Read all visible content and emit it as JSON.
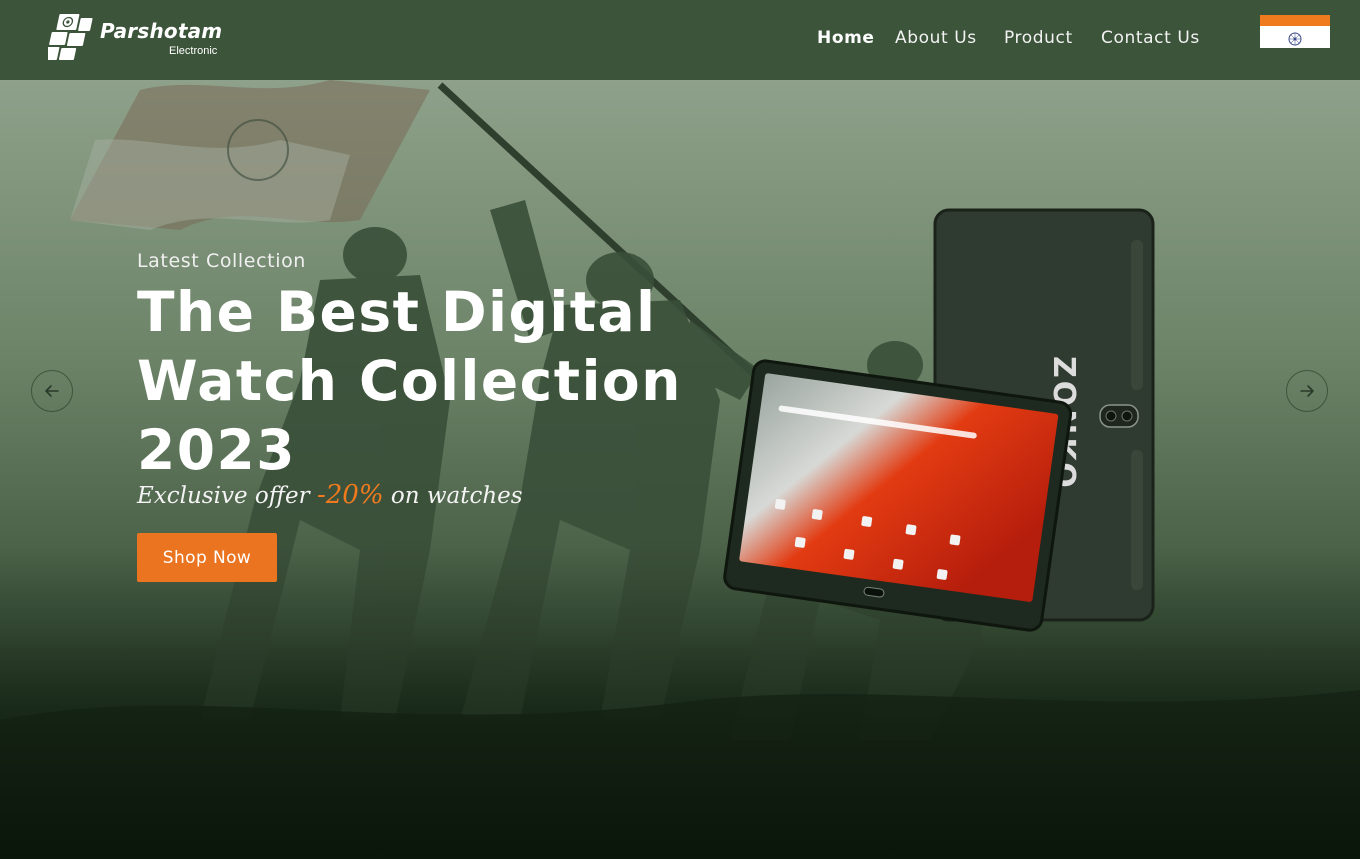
{
  "brand": {
    "name": "Parshotam",
    "tagline": "Electronic"
  },
  "nav": {
    "items": [
      {
        "label": "Home",
        "active": true
      },
      {
        "label": "About Us",
        "active": false
      },
      {
        "label": "Product",
        "active": false
      },
      {
        "label": "Contact Us",
        "active": false
      }
    ]
  },
  "hero": {
    "eyebrow": "Latest Collection",
    "headline_line1": "The Best Digital",
    "headline_line2": "Watch Collection",
    "headline_line3": "2023",
    "offer_prefix": "Exclusive offer ",
    "offer_percent": "-20%",
    "offer_suffix": " on watches",
    "cta_label": "Shop Now",
    "tablet_brand": "ZONKO"
  },
  "icons": {
    "prev": "arrow-left-icon",
    "next": "arrow-right-icon",
    "flag": "india-flag-icon",
    "logo": "chip-logo-icon"
  },
  "colors": {
    "header_bg": "#3c543a",
    "accent": "#ea7420",
    "offer_highlight": "#f07a1e",
    "hero_tint": "#5f7a5c",
    "text": "#ffffff"
  }
}
